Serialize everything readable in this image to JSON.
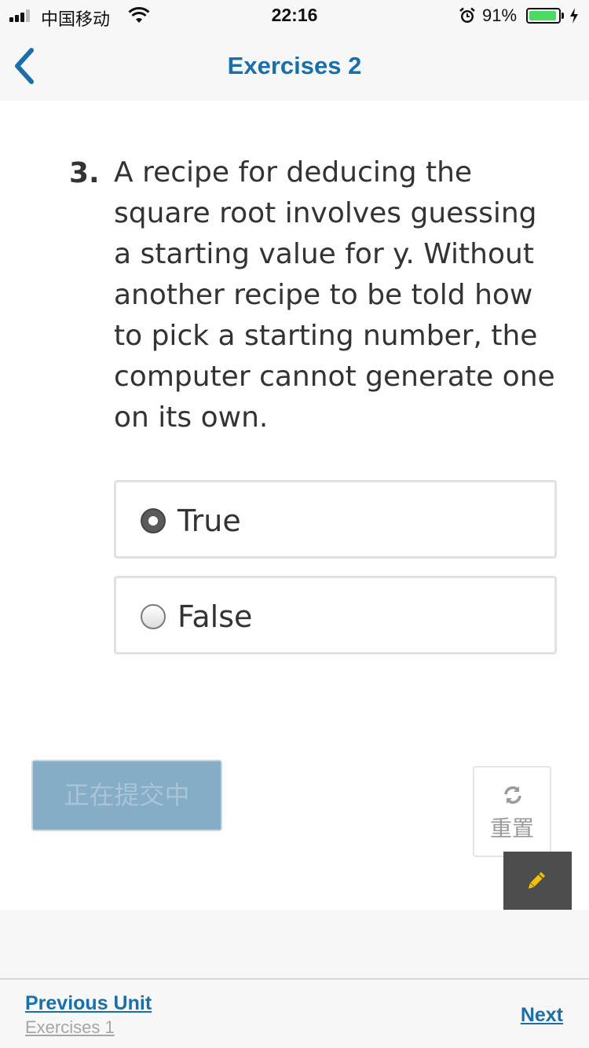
{
  "status_bar": {
    "carrier": "中国移动",
    "time": "22:16",
    "battery_percent": "91%",
    "battery_color": "#4cd964",
    "icons": [
      "signal-icon",
      "wifi-icon",
      "alarm-icon",
      "battery-icon",
      "charging-icon"
    ]
  },
  "nav": {
    "title": "Exercises 2",
    "back_icon": "chevron-left-icon",
    "accent": "#1a6fa8"
  },
  "question": {
    "number": "3.",
    "text": "A recipe for deducing the square root involves guessing a starting value for y. Without another recipe to be told how to pick a starting number, the computer cannot generate one on its own.",
    "options": [
      {
        "label": "True",
        "selected": true
      },
      {
        "label": "False",
        "selected": false
      }
    ]
  },
  "actions": {
    "submit_label": "正在提交中",
    "reset_label": "重置",
    "reset_icon": "refresh-icon",
    "edit_icon": "pencil-icon"
  },
  "footer": {
    "previous_label": "Previous Unit",
    "previous_sub": "Exercises 1",
    "next_label": "Next"
  }
}
